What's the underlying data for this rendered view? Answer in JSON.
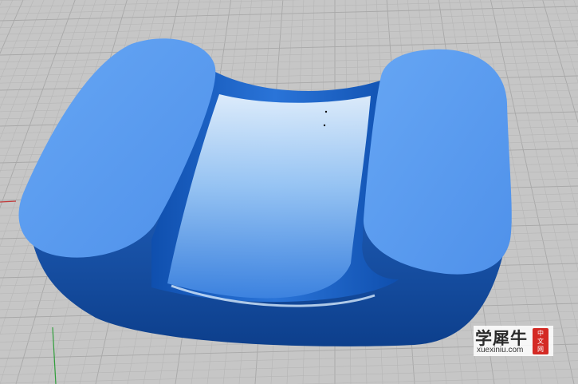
{
  "viewport": {
    "background": "#c6c6c6",
    "grid_minor_color": "#b6b6b6",
    "grid_major_color": "#a8a8a8",
    "axis_y_color": "#2f9e3a",
    "axis_x_color": "#c23a3a"
  },
  "model": {
    "pad_color": "#5b9cf0",
    "body_color": "#1e5fb8",
    "body_dark": "#0e3f88",
    "channel_highlight": "#cfe4fb"
  },
  "watermark": {
    "title": "学犀牛",
    "domain": "xuexiniu.com",
    "seal": [
      "中",
      "文",
      "网"
    ]
  }
}
